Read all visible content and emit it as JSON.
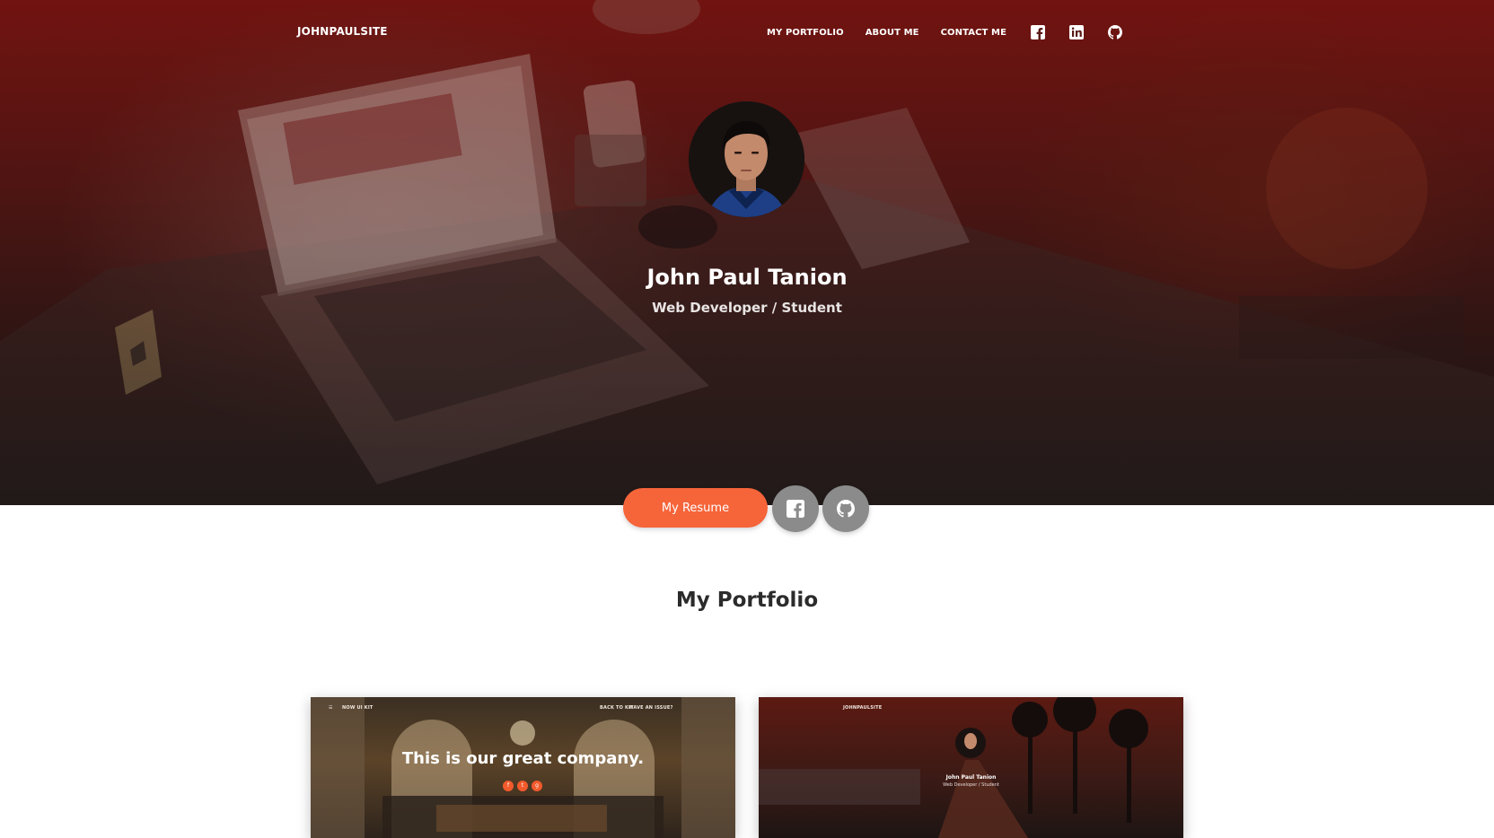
{
  "brand": "JOHNPAULSITE",
  "nav": {
    "links": [
      "MY PORTFOLIO",
      "ABOUT ME",
      "CONTACT ME"
    ],
    "icons": [
      "facebook-icon",
      "linkedin-icon",
      "github-icon"
    ]
  },
  "hero": {
    "name": "John Paul Tanion",
    "role": "Web Developer / Student",
    "resume_label": "My Resume",
    "social_buttons": [
      "facebook-icon",
      "github-icon"
    ]
  },
  "portfolio": {
    "title": "My Portfolio",
    "cards": [
      {
        "headline": "This is our great company.",
        "nav_left": "NOW UI KIT",
        "nav_right": [
          "BACK TO KIT",
          "HAVE AN ISSUE?"
        ]
      },
      {
        "brand": "JOHNPAULSITE",
        "name": "John Paul Tanion",
        "role": "Web Developer / Student"
      }
    ]
  },
  "colors": {
    "accent": "#f6643a",
    "hero_top": "#6e1414",
    "hero_bottom": "#1c1818",
    "social_button": "#8b8b8b",
    "heading": "#2b2b2b"
  }
}
